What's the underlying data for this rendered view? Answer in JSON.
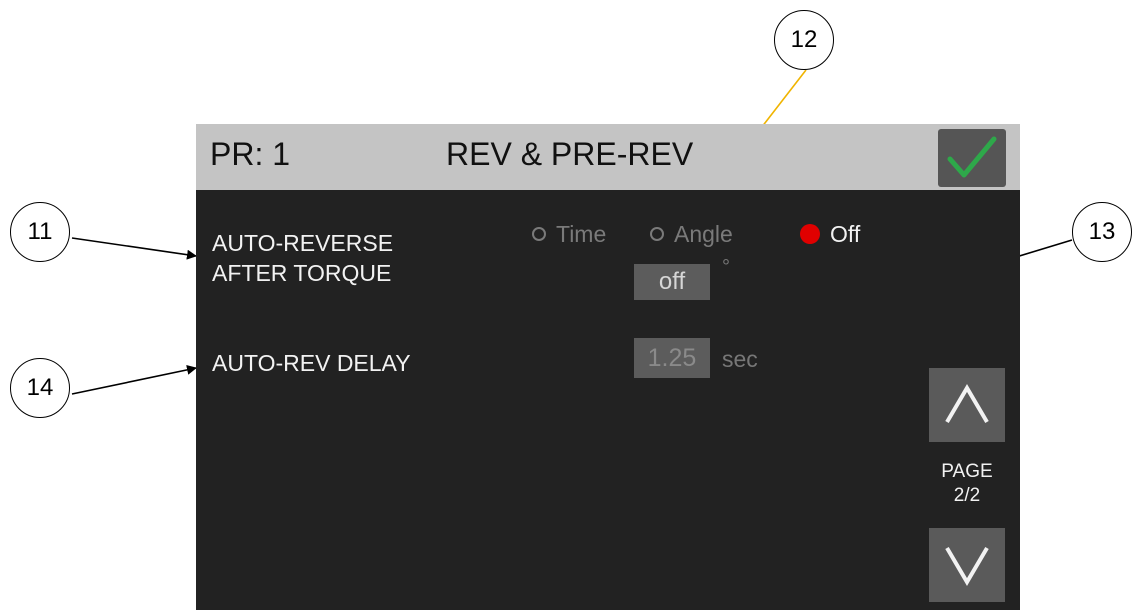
{
  "header": {
    "pr_label": "PR: 1",
    "title": "REV & PRE-REV",
    "confirm_icon": "checkmark-icon"
  },
  "auto_reverse": {
    "label_line1": "AUTO-REVERSE",
    "label_line2": "AFTER TORQUE",
    "options": [
      "Time",
      "Angle",
      "Off"
    ],
    "selected": "Off",
    "value": "off",
    "unit": "°"
  },
  "auto_rev_delay": {
    "label": "AUTO-REV DELAY",
    "value": "1.25",
    "unit": "sec"
  },
  "pager": {
    "label_line1": "PAGE",
    "label_line2": "2/2",
    "up_icon": "chevron-up-icon",
    "down_icon": "chevron-down-icon"
  },
  "callouts": {
    "c11": "11",
    "c12": "12",
    "c13": "13",
    "c14": "14"
  },
  "colors": {
    "screen_bg": "#222222",
    "header_bg": "#c4c4c4",
    "button_bg": "#5a5a5a",
    "check_green": "#2ea84a",
    "radio_selected": "#e00000",
    "arrow_12": "#f0b400",
    "arrow_black": "#000000"
  }
}
